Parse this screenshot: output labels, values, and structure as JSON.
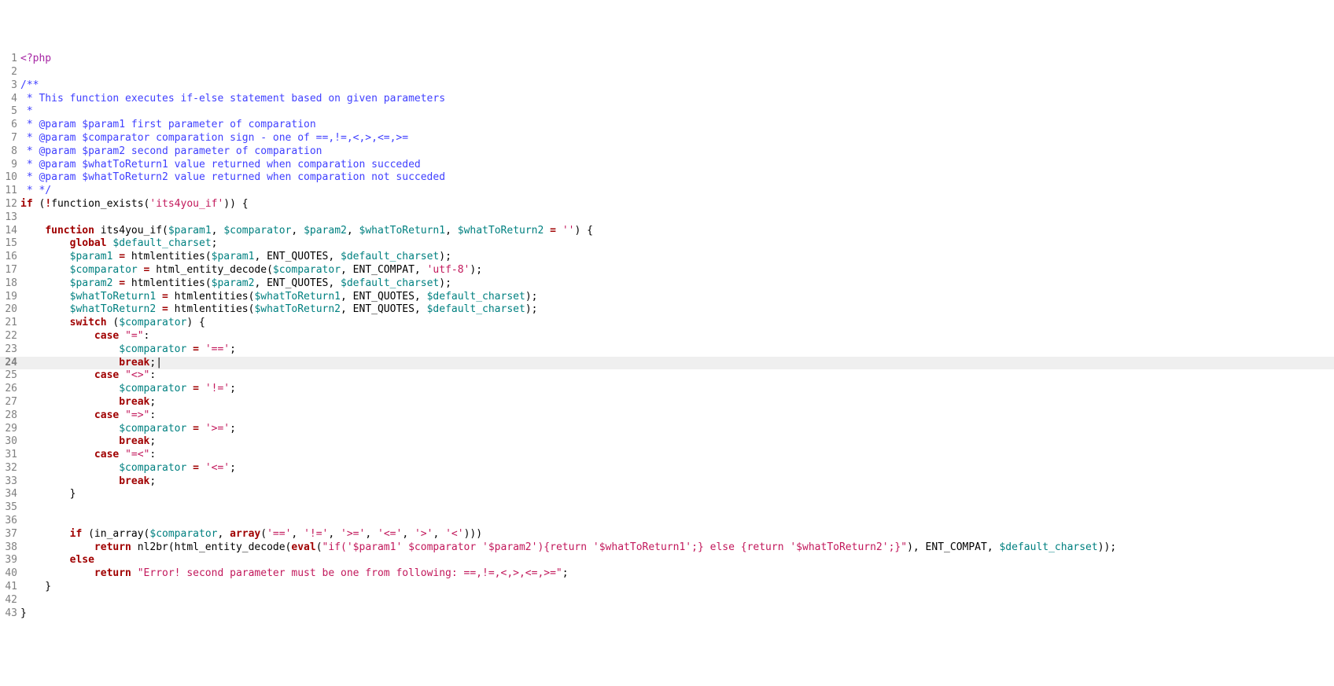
{
  "highlight_line": 24,
  "lines": [
    [
      {
        "c": "c-tag",
        "t": "<?php"
      }
    ],
    [],
    [
      {
        "c": "c-comment",
        "t": "/**"
      }
    ],
    [
      {
        "c": "c-comment",
        "t": " * This function executes if-else statement based on given parameters"
      }
    ],
    [
      {
        "c": "c-comment",
        "t": " *"
      }
    ],
    [
      {
        "c": "c-comment",
        "t": " * @param $param1 first parameter of comparation"
      }
    ],
    [
      {
        "c": "c-comment",
        "t": " * @param $comparator comparation sign - one of ==,!=,<,>,<=,>="
      }
    ],
    [
      {
        "c": "c-comment",
        "t": " * @param $param2 second parameter of comparation"
      }
    ],
    [
      {
        "c": "c-comment",
        "t": " * @param $whatToReturn1 value returned when comparation succeded"
      }
    ],
    [
      {
        "c": "c-comment",
        "t": " * @param $whatToReturn2 value returned when comparation not succeded"
      }
    ],
    [
      {
        "c": "c-comment",
        "t": " * */"
      }
    ],
    [
      {
        "c": "c-kw",
        "t": "if"
      },
      {
        "c": "c-plain",
        "t": " ("
      },
      {
        "c": "c-op",
        "t": "!"
      },
      {
        "c": "c-plain",
        "t": "function_exists("
      },
      {
        "c": "c-str",
        "t": "'its4you_if'"
      },
      {
        "c": "c-plain",
        "t": ")) {"
      }
    ],
    [],
    [
      {
        "c": "c-plain",
        "t": "    "
      },
      {
        "c": "c-kw",
        "t": "function"
      },
      {
        "c": "c-plain",
        "t": " its4you_if("
      },
      {
        "c": "c-var",
        "t": "$param1"
      },
      {
        "c": "c-plain",
        "t": ", "
      },
      {
        "c": "c-var",
        "t": "$comparator"
      },
      {
        "c": "c-plain",
        "t": ", "
      },
      {
        "c": "c-var",
        "t": "$param2"
      },
      {
        "c": "c-plain",
        "t": ", "
      },
      {
        "c": "c-var",
        "t": "$whatToReturn1"
      },
      {
        "c": "c-plain",
        "t": ", "
      },
      {
        "c": "c-var",
        "t": "$whatToReturn2"
      },
      {
        "c": "c-plain",
        "t": " "
      },
      {
        "c": "c-op",
        "t": "="
      },
      {
        "c": "c-plain",
        "t": " "
      },
      {
        "c": "c-str",
        "t": "''"
      },
      {
        "c": "c-plain",
        "t": ") {"
      }
    ],
    [
      {
        "c": "c-plain",
        "t": "        "
      },
      {
        "c": "c-kw",
        "t": "global"
      },
      {
        "c": "c-plain",
        "t": " "
      },
      {
        "c": "c-var",
        "t": "$default_charset"
      },
      {
        "c": "c-plain",
        "t": ";"
      }
    ],
    [
      {
        "c": "c-plain",
        "t": "        "
      },
      {
        "c": "c-var",
        "t": "$param1"
      },
      {
        "c": "c-plain",
        "t": " "
      },
      {
        "c": "c-op",
        "t": "="
      },
      {
        "c": "c-plain",
        "t": " htmlentities("
      },
      {
        "c": "c-var",
        "t": "$param1"
      },
      {
        "c": "c-plain",
        "t": ", ENT_QUOTES, "
      },
      {
        "c": "c-var",
        "t": "$default_charset"
      },
      {
        "c": "c-plain",
        "t": ");"
      }
    ],
    [
      {
        "c": "c-plain",
        "t": "        "
      },
      {
        "c": "c-var",
        "t": "$comparator"
      },
      {
        "c": "c-plain",
        "t": " "
      },
      {
        "c": "c-op",
        "t": "="
      },
      {
        "c": "c-plain",
        "t": " html_entity_decode("
      },
      {
        "c": "c-var",
        "t": "$comparator"
      },
      {
        "c": "c-plain",
        "t": ", ENT_COMPAT, "
      },
      {
        "c": "c-str",
        "t": "'utf-8'"
      },
      {
        "c": "c-plain",
        "t": ");"
      }
    ],
    [
      {
        "c": "c-plain",
        "t": "        "
      },
      {
        "c": "c-var",
        "t": "$param2"
      },
      {
        "c": "c-plain",
        "t": " "
      },
      {
        "c": "c-op",
        "t": "="
      },
      {
        "c": "c-plain",
        "t": " htmlentities("
      },
      {
        "c": "c-var",
        "t": "$param2"
      },
      {
        "c": "c-plain",
        "t": ", ENT_QUOTES, "
      },
      {
        "c": "c-var",
        "t": "$default_charset"
      },
      {
        "c": "c-plain",
        "t": ");"
      }
    ],
    [
      {
        "c": "c-plain",
        "t": "        "
      },
      {
        "c": "c-var",
        "t": "$whatToReturn1"
      },
      {
        "c": "c-plain",
        "t": " "
      },
      {
        "c": "c-op",
        "t": "="
      },
      {
        "c": "c-plain",
        "t": " htmlentities("
      },
      {
        "c": "c-var",
        "t": "$whatToReturn1"
      },
      {
        "c": "c-plain",
        "t": ", ENT_QUOTES, "
      },
      {
        "c": "c-var",
        "t": "$default_charset"
      },
      {
        "c": "c-plain",
        "t": ");"
      }
    ],
    [
      {
        "c": "c-plain",
        "t": "        "
      },
      {
        "c": "c-var",
        "t": "$whatToReturn2"
      },
      {
        "c": "c-plain",
        "t": " "
      },
      {
        "c": "c-op",
        "t": "="
      },
      {
        "c": "c-plain",
        "t": " htmlentities("
      },
      {
        "c": "c-var",
        "t": "$whatToReturn2"
      },
      {
        "c": "c-plain",
        "t": ", ENT_QUOTES, "
      },
      {
        "c": "c-var",
        "t": "$default_charset"
      },
      {
        "c": "c-plain",
        "t": ");"
      }
    ],
    [
      {
        "c": "c-plain",
        "t": "        "
      },
      {
        "c": "c-kw",
        "t": "switch"
      },
      {
        "c": "c-plain",
        "t": " ("
      },
      {
        "c": "c-var",
        "t": "$comparator"
      },
      {
        "c": "c-plain",
        "t": ") {"
      }
    ],
    [
      {
        "c": "c-plain",
        "t": "            "
      },
      {
        "c": "c-kw",
        "t": "case"
      },
      {
        "c": "c-plain",
        "t": " "
      },
      {
        "c": "c-str",
        "t": "\"=\""
      },
      {
        "c": "c-plain",
        "t": ":"
      }
    ],
    [
      {
        "c": "c-plain",
        "t": "                "
      },
      {
        "c": "c-var",
        "t": "$comparator"
      },
      {
        "c": "c-plain",
        "t": " "
      },
      {
        "c": "c-op",
        "t": "="
      },
      {
        "c": "c-plain",
        "t": " "
      },
      {
        "c": "c-str",
        "t": "'=='"
      },
      {
        "c": "c-plain",
        "t": ";"
      }
    ],
    [
      {
        "c": "c-plain",
        "t": "                "
      },
      {
        "c": "c-kw",
        "t": "break"
      },
      {
        "c": "c-plain",
        "t": ";|"
      }
    ],
    [
      {
        "c": "c-plain",
        "t": "            "
      },
      {
        "c": "c-kw",
        "t": "case"
      },
      {
        "c": "c-plain",
        "t": " "
      },
      {
        "c": "c-str",
        "t": "\"<>\""
      },
      {
        "c": "c-plain",
        "t": ":"
      }
    ],
    [
      {
        "c": "c-plain",
        "t": "                "
      },
      {
        "c": "c-var",
        "t": "$comparator"
      },
      {
        "c": "c-plain",
        "t": " "
      },
      {
        "c": "c-op",
        "t": "="
      },
      {
        "c": "c-plain",
        "t": " "
      },
      {
        "c": "c-str",
        "t": "'!='"
      },
      {
        "c": "c-plain",
        "t": ";"
      }
    ],
    [
      {
        "c": "c-plain",
        "t": "                "
      },
      {
        "c": "c-kw",
        "t": "break"
      },
      {
        "c": "c-plain",
        "t": ";"
      }
    ],
    [
      {
        "c": "c-plain",
        "t": "            "
      },
      {
        "c": "c-kw",
        "t": "case"
      },
      {
        "c": "c-plain",
        "t": " "
      },
      {
        "c": "c-str",
        "t": "\"=>\""
      },
      {
        "c": "c-plain",
        "t": ":"
      }
    ],
    [
      {
        "c": "c-plain",
        "t": "                "
      },
      {
        "c": "c-var",
        "t": "$comparator"
      },
      {
        "c": "c-plain",
        "t": " "
      },
      {
        "c": "c-op",
        "t": "="
      },
      {
        "c": "c-plain",
        "t": " "
      },
      {
        "c": "c-str",
        "t": "'>='"
      },
      {
        "c": "c-plain",
        "t": ";"
      }
    ],
    [
      {
        "c": "c-plain",
        "t": "                "
      },
      {
        "c": "c-kw",
        "t": "break"
      },
      {
        "c": "c-plain",
        "t": ";"
      }
    ],
    [
      {
        "c": "c-plain",
        "t": "            "
      },
      {
        "c": "c-kw",
        "t": "case"
      },
      {
        "c": "c-plain",
        "t": " "
      },
      {
        "c": "c-str",
        "t": "\"=<\""
      },
      {
        "c": "c-plain",
        "t": ":"
      }
    ],
    [
      {
        "c": "c-plain",
        "t": "                "
      },
      {
        "c": "c-var",
        "t": "$comparator"
      },
      {
        "c": "c-plain",
        "t": " "
      },
      {
        "c": "c-op",
        "t": "="
      },
      {
        "c": "c-plain",
        "t": " "
      },
      {
        "c": "c-str",
        "t": "'<='"
      },
      {
        "c": "c-plain",
        "t": ";"
      }
    ],
    [
      {
        "c": "c-plain",
        "t": "                "
      },
      {
        "c": "c-kw",
        "t": "break"
      },
      {
        "c": "c-plain",
        "t": ";"
      }
    ],
    [
      {
        "c": "c-plain",
        "t": "        }"
      }
    ],
    [],
    [],
    [
      {
        "c": "c-plain",
        "t": "        "
      },
      {
        "c": "c-kw",
        "t": "if"
      },
      {
        "c": "c-plain",
        "t": " (in_array("
      },
      {
        "c": "c-var",
        "t": "$comparator"
      },
      {
        "c": "c-plain",
        "t": ", "
      },
      {
        "c": "c-kw",
        "t": "array"
      },
      {
        "c": "c-plain",
        "t": "("
      },
      {
        "c": "c-str",
        "t": "'=='"
      },
      {
        "c": "c-plain",
        "t": ", "
      },
      {
        "c": "c-str",
        "t": "'!='"
      },
      {
        "c": "c-plain",
        "t": ", "
      },
      {
        "c": "c-str",
        "t": "'>='"
      },
      {
        "c": "c-plain",
        "t": ", "
      },
      {
        "c": "c-str",
        "t": "'<='"
      },
      {
        "c": "c-plain",
        "t": ", "
      },
      {
        "c": "c-str",
        "t": "'>'"
      },
      {
        "c": "c-plain",
        "t": ", "
      },
      {
        "c": "c-str",
        "t": "'<'"
      },
      {
        "c": "c-plain",
        "t": ")))"
      }
    ],
    [
      {
        "c": "c-plain",
        "t": "            "
      },
      {
        "c": "c-kw",
        "t": "return"
      },
      {
        "c": "c-plain",
        "t": " nl2br(html_entity_decode("
      },
      {
        "c": "c-kw",
        "t": "eval"
      },
      {
        "c": "c-plain",
        "t": "("
      },
      {
        "c": "c-str",
        "t": "\"if('$param1' $comparator '$param2'){return '$whatToReturn1';} else {return '$whatToReturn2';}\""
      },
      {
        "c": "c-plain",
        "t": "), ENT_COMPAT, "
      },
      {
        "c": "c-var",
        "t": "$default_charset"
      },
      {
        "c": "c-plain",
        "t": "));"
      }
    ],
    [
      {
        "c": "c-plain",
        "t": "        "
      },
      {
        "c": "c-kw",
        "t": "else"
      }
    ],
    [
      {
        "c": "c-plain",
        "t": "            "
      },
      {
        "c": "c-kw",
        "t": "return"
      },
      {
        "c": "c-plain",
        "t": " "
      },
      {
        "c": "c-str",
        "t": "\"Error! second parameter must be one from following: ==,!=,<,>,<=,>=\""
      },
      {
        "c": "c-plain",
        "t": ";"
      }
    ],
    [
      {
        "c": "c-plain",
        "t": "    }"
      }
    ],
    [],
    [
      {
        "c": "c-plain",
        "t": "}"
      }
    ]
  ]
}
